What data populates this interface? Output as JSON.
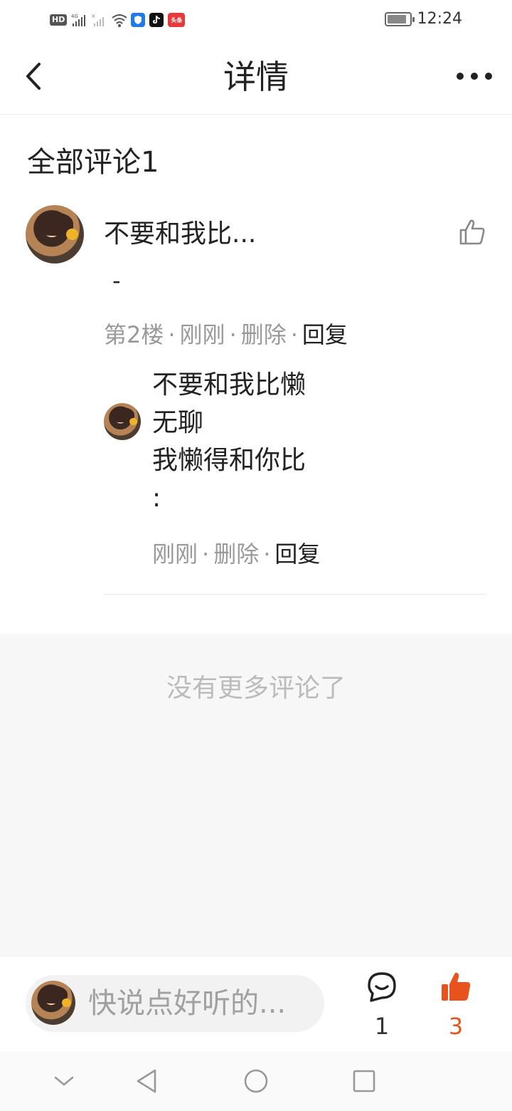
{
  "status_bar": {
    "network": "HD",
    "signal_label": "4G",
    "apps": [
      "shield-app-icon",
      "tiktok-app-icon",
      "toutiao-app-icon"
    ],
    "toutiao_label": "头条",
    "time": "12:24"
  },
  "header": {
    "title": "详情"
  },
  "comments": {
    "title": "全部评论1",
    "main": {
      "user": "不要和我比...",
      "text": "-",
      "floor": "第2楼",
      "time": "刚刚",
      "delete_label": "删除",
      "reply_label": "回复"
    },
    "reply": {
      "lines": [
        "不要和我比懒",
        "无聊",
        "我懒得和你比",
        ":"
      ],
      "time": "刚刚",
      "delete_label": "删除",
      "reply_label": "回复"
    },
    "end_text": "没有更多评论了"
  },
  "bottom_bar": {
    "placeholder": "快说点好听的...",
    "comment_count": "1",
    "like_count": "3",
    "like_color": "#e8531d"
  },
  "colors": {
    "accent": "#e8531d",
    "muted_text": "#999999",
    "gray_bg": "#f7f7f7"
  }
}
